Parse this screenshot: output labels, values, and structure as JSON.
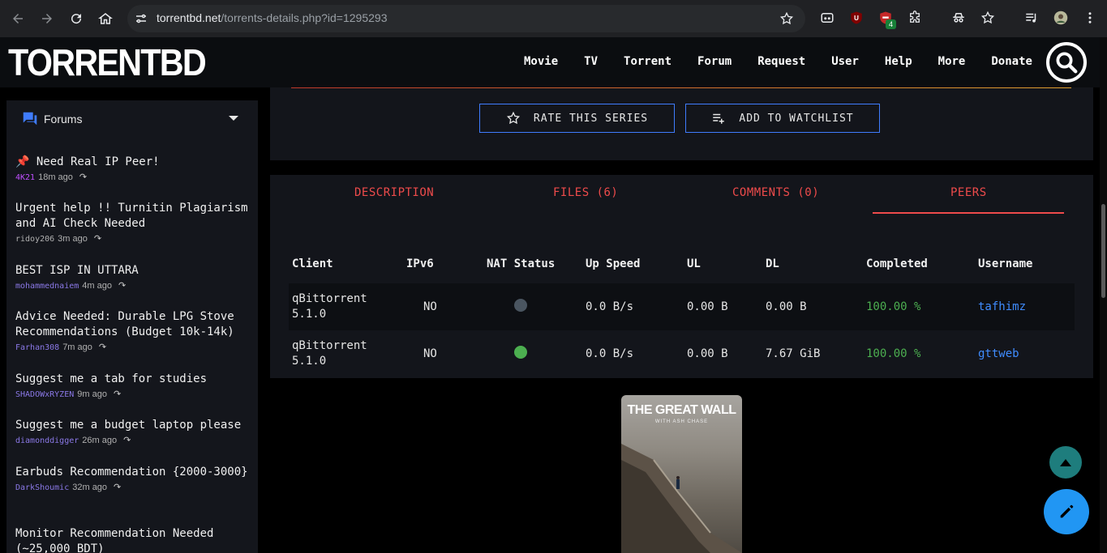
{
  "browser": {
    "url_host": "torrentbd.net",
    "url_path": "/torrents-details.php?id=1295293",
    "ext_badge": "4"
  },
  "site": {
    "logo": "TORRENTBD",
    "nav": [
      "Movie",
      "TV",
      "Torrent",
      "Forum",
      "Request",
      "User",
      "Help",
      "More",
      "Donate"
    ]
  },
  "sidebar": {
    "title": "Forums",
    "topics": [
      {
        "title": "📌 Need Real IP Peer!",
        "user": "4K21",
        "time": "18m ago",
        "user_color": "#c04fff"
      },
      {
        "title": "Urgent help !! Turnitin Plagiarism and AI Check Needed",
        "user": "ridoy206",
        "time": "3m ago",
        "user_color": "#b0b0b0"
      },
      {
        "title": "BEST ISP IN UTTARA",
        "user": "mohammednaiem",
        "time": "4m ago",
        "user_color": "#8a78e6"
      },
      {
        "title": "Advice Needed: Durable LPG Stove Recommendations (Budget 10k-14k)",
        "user": "Farhan308",
        "time": "7m ago",
        "user_color": "#8a78e6"
      },
      {
        "title": "Suggest me a tab for studies",
        "user": "SHADOWxRYZEN",
        "time": "9m ago",
        "user_color": "#8a78e6"
      },
      {
        "title": "Suggest me a budget laptop please",
        "user": "diamonddigger",
        "time": "26m ago",
        "user_color": "#8a78e6"
      },
      {
        "title": "Earbuds Recommendation {2000-3000}",
        "user": "DarkShoumic",
        "time": "32m ago",
        "user_color": "#8a78e6"
      },
      {
        "title": "Monitor Recommendation Needed (~25,000 BDT)",
        "user": "",
        "time": "",
        "user_color": "#8a78e6"
      }
    ]
  },
  "actions": {
    "rate": "RATE THIS SERIES",
    "watchlist": "ADD TO WATCHLIST"
  },
  "tabs": [
    "DESCRIPTION",
    "FILES (6)",
    "COMMENTS (0)",
    "PEERS"
  ],
  "active_tab": "PEERS",
  "peers": {
    "columns": [
      "Client",
      "IPv6",
      "NAT Status",
      "Up Speed",
      "UL",
      "DL",
      "Completed",
      "Username"
    ],
    "rows": [
      {
        "client": "qBittorrent 5.1.0",
        "ipv6": "NO",
        "nat_color": "#4a5560",
        "up_speed": "0.0 B/s",
        "ul": "0.00 B",
        "dl": "0.00 B",
        "completed": "100.00 %",
        "username": "tafhimz"
      },
      {
        "client": "qBittorrent 5.1.0",
        "ipv6": "NO",
        "nat_color": "#4caf50",
        "up_speed": "0.0 B/s",
        "ul": "0.00 B",
        "dl": "7.67 GiB",
        "completed": "100.00 %",
        "username": "gttweb"
      }
    ]
  },
  "poster": {
    "title": "THE GREAT WALL",
    "subtitle": "WITH ASH CHASE"
  },
  "colors": {
    "accent_red": "#ee4b4b",
    "accent_blue": "#3f7cff",
    "completed_green": "#4caf50",
    "fab_edit": "#2196f3",
    "fab_up": "#1e7d7d"
  }
}
